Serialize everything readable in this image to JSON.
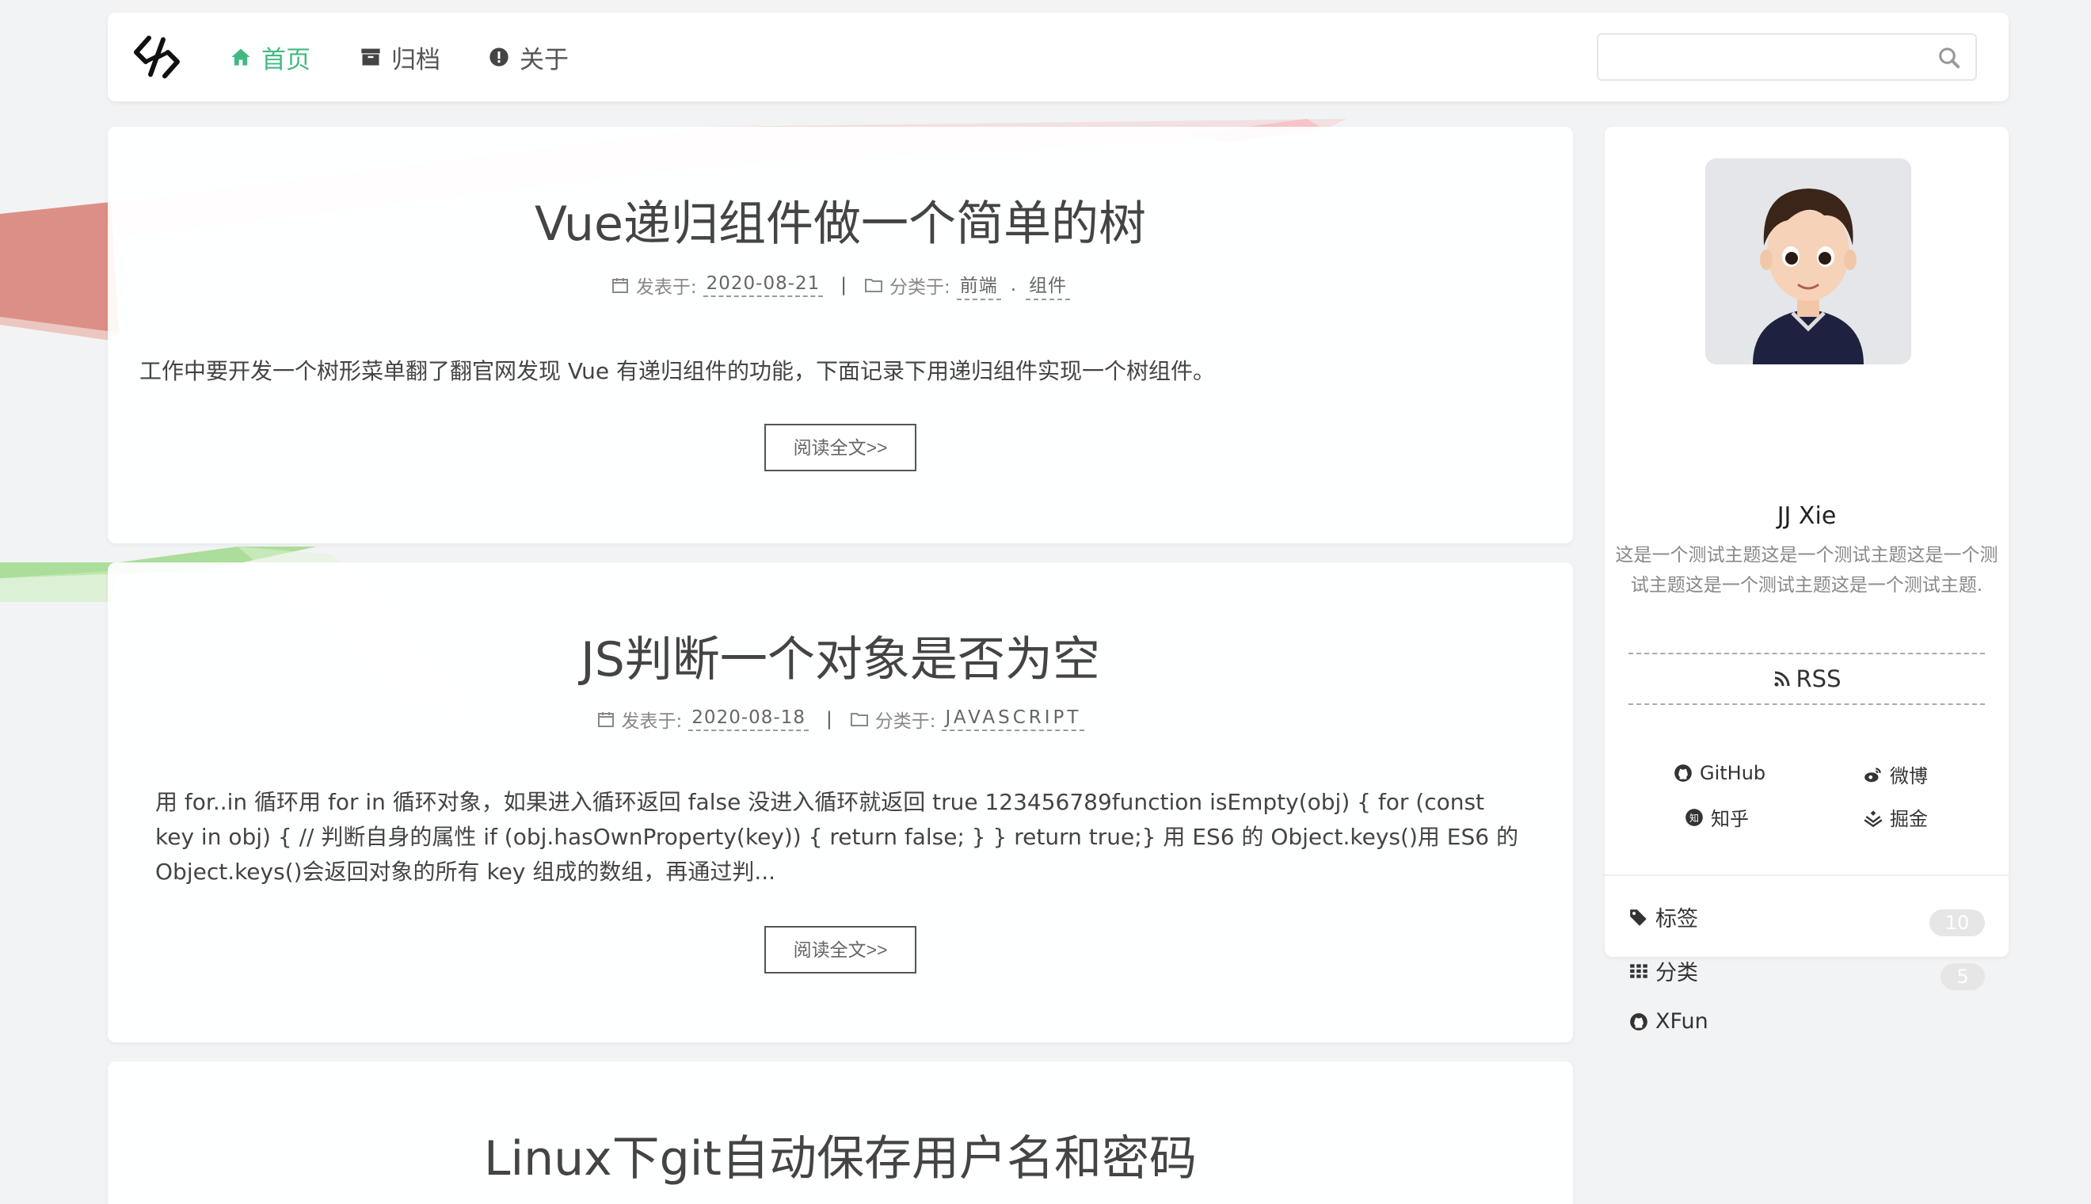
{
  "nav": {
    "items": [
      {
        "label": "首页",
        "icon": "home-icon",
        "active": true
      },
      {
        "label": "归档",
        "icon": "archive-icon",
        "active": false
      },
      {
        "label": "关于",
        "icon": "info-icon",
        "active": false
      }
    ],
    "search_placeholder": ""
  },
  "colors": {
    "accent": "#42b983"
  },
  "posts": [
    {
      "title": "Vue递归组件做一个简单的树",
      "date_label": "发表于:",
      "date": "2020-08-21",
      "category_label": "分类于:",
      "categories": [
        "前端",
        "组件"
      ],
      "excerpt": "工作中要开发一个树形菜单翻了翻官网发现 Vue 有递归组件的功能，下面记录下用递归组件实现一个树组件。",
      "read_more": "阅读全文>>"
    },
    {
      "title": "JS判断一个对象是否为空",
      "date_label": "发表于:",
      "date": "2020-08-18",
      "category_label": "分类于:",
      "categories": [
        "JAVASCRIPT"
      ],
      "excerpt": "用 for..in 循环用 for in 循环对象，如果进入循环返回 false 没进入循环就返回 true 123456789function isEmpty(obj) { for (const key in obj) { // 判断自身的属性 if (obj.hasOwnProperty(key)) { return false; } } return true;} 用 ES6 的 Object.keys()用 ES6 的 Object.keys()会返回对象的所有 key 组成的数组，再通过判...",
      "read_more": "阅读全文>>"
    },
    {
      "title": "Linux下git自动保存用户名和密码"
    }
  ],
  "sidebar": {
    "author": "JJ Xie",
    "bio": "这是一个测试主题这是一个测试主题这是一个测试主题这是一个测试主题这是一个测试主题.",
    "rss": "RSS",
    "social": [
      {
        "label": "GitHub",
        "icon": "github-icon"
      },
      {
        "label": "微博",
        "icon": "weibo-icon"
      },
      {
        "label": "知乎",
        "icon": "zhihu-icon"
      },
      {
        "label": "掘金",
        "icon": "juejin-icon"
      }
    ],
    "links": [
      {
        "label": "标签",
        "icon": "tag-icon",
        "count": "10"
      },
      {
        "label": "分类",
        "icon": "grid-icon",
        "count": "5"
      },
      {
        "label": "XFun",
        "icon": "github-icon",
        "count": null
      }
    ]
  }
}
